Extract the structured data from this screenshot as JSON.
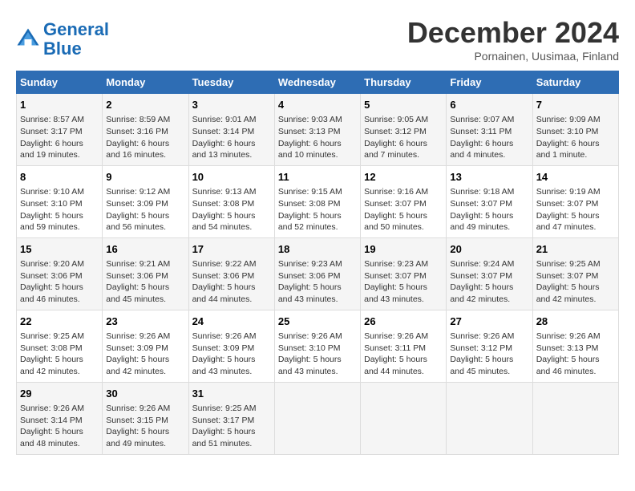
{
  "logo": {
    "line1": "General",
    "line2": "Blue"
  },
  "title": "December 2024",
  "subtitle": "Pornainen, Uusimaa, Finland",
  "days_of_week": [
    "Sunday",
    "Monday",
    "Tuesday",
    "Wednesday",
    "Thursday",
    "Friday",
    "Saturday"
  ],
  "weeks": [
    [
      {
        "day": 1,
        "sunrise": "Sunrise: 8:57 AM",
        "sunset": "Sunset: 3:17 PM",
        "daylight": "Daylight: 6 hours and 19 minutes."
      },
      {
        "day": 2,
        "sunrise": "Sunrise: 8:59 AM",
        "sunset": "Sunset: 3:16 PM",
        "daylight": "Daylight: 6 hours and 16 minutes."
      },
      {
        "day": 3,
        "sunrise": "Sunrise: 9:01 AM",
        "sunset": "Sunset: 3:14 PM",
        "daylight": "Daylight: 6 hours and 13 minutes."
      },
      {
        "day": 4,
        "sunrise": "Sunrise: 9:03 AM",
        "sunset": "Sunset: 3:13 PM",
        "daylight": "Daylight: 6 hours and 10 minutes."
      },
      {
        "day": 5,
        "sunrise": "Sunrise: 9:05 AM",
        "sunset": "Sunset: 3:12 PM",
        "daylight": "Daylight: 6 hours and 7 minutes."
      },
      {
        "day": 6,
        "sunrise": "Sunrise: 9:07 AM",
        "sunset": "Sunset: 3:11 PM",
        "daylight": "Daylight: 6 hours and 4 minutes."
      },
      {
        "day": 7,
        "sunrise": "Sunrise: 9:09 AM",
        "sunset": "Sunset: 3:10 PM",
        "daylight": "Daylight: 6 hours and 1 minute."
      }
    ],
    [
      {
        "day": 8,
        "sunrise": "Sunrise: 9:10 AM",
        "sunset": "Sunset: 3:10 PM",
        "daylight": "Daylight: 5 hours and 59 minutes."
      },
      {
        "day": 9,
        "sunrise": "Sunrise: 9:12 AM",
        "sunset": "Sunset: 3:09 PM",
        "daylight": "Daylight: 5 hours and 56 minutes."
      },
      {
        "day": 10,
        "sunrise": "Sunrise: 9:13 AM",
        "sunset": "Sunset: 3:08 PM",
        "daylight": "Daylight: 5 hours and 54 minutes."
      },
      {
        "day": 11,
        "sunrise": "Sunrise: 9:15 AM",
        "sunset": "Sunset: 3:08 PM",
        "daylight": "Daylight: 5 hours and 52 minutes."
      },
      {
        "day": 12,
        "sunrise": "Sunrise: 9:16 AM",
        "sunset": "Sunset: 3:07 PM",
        "daylight": "Daylight: 5 hours and 50 minutes."
      },
      {
        "day": 13,
        "sunrise": "Sunrise: 9:18 AM",
        "sunset": "Sunset: 3:07 PM",
        "daylight": "Daylight: 5 hours and 49 minutes."
      },
      {
        "day": 14,
        "sunrise": "Sunrise: 9:19 AM",
        "sunset": "Sunset: 3:07 PM",
        "daylight": "Daylight: 5 hours and 47 minutes."
      }
    ],
    [
      {
        "day": 15,
        "sunrise": "Sunrise: 9:20 AM",
        "sunset": "Sunset: 3:06 PM",
        "daylight": "Daylight: 5 hours and 46 minutes."
      },
      {
        "day": 16,
        "sunrise": "Sunrise: 9:21 AM",
        "sunset": "Sunset: 3:06 PM",
        "daylight": "Daylight: 5 hours and 45 minutes."
      },
      {
        "day": 17,
        "sunrise": "Sunrise: 9:22 AM",
        "sunset": "Sunset: 3:06 PM",
        "daylight": "Daylight: 5 hours and 44 minutes."
      },
      {
        "day": 18,
        "sunrise": "Sunrise: 9:23 AM",
        "sunset": "Sunset: 3:06 PM",
        "daylight": "Daylight: 5 hours and 43 minutes."
      },
      {
        "day": 19,
        "sunrise": "Sunrise: 9:23 AM",
        "sunset": "Sunset: 3:07 PM",
        "daylight": "Daylight: 5 hours and 43 minutes."
      },
      {
        "day": 20,
        "sunrise": "Sunrise: 9:24 AM",
        "sunset": "Sunset: 3:07 PM",
        "daylight": "Daylight: 5 hours and 42 minutes."
      },
      {
        "day": 21,
        "sunrise": "Sunrise: 9:25 AM",
        "sunset": "Sunset: 3:07 PM",
        "daylight": "Daylight: 5 hours and 42 minutes."
      }
    ],
    [
      {
        "day": 22,
        "sunrise": "Sunrise: 9:25 AM",
        "sunset": "Sunset: 3:08 PM",
        "daylight": "Daylight: 5 hours and 42 minutes."
      },
      {
        "day": 23,
        "sunrise": "Sunrise: 9:26 AM",
        "sunset": "Sunset: 3:09 PM",
        "daylight": "Daylight: 5 hours and 42 minutes."
      },
      {
        "day": 24,
        "sunrise": "Sunrise: 9:26 AM",
        "sunset": "Sunset: 3:09 PM",
        "daylight": "Daylight: 5 hours and 43 minutes."
      },
      {
        "day": 25,
        "sunrise": "Sunrise: 9:26 AM",
        "sunset": "Sunset: 3:10 PM",
        "daylight": "Daylight: 5 hours and 43 minutes."
      },
      {
        "day": 26,
        "sunrise": "Sunrise: 9:26 AM",
        "sunset": "Sunset: 3:11 PM",
        "daylight": "Daylight: 5 hours and 44 minutes."
      },
      {
        "day": 27,
        "sunrise": "Sunrise: 9:26 AM",
        "sunset": "Sunset: 3:12 PM",
        "daylight": "Daylight: 5 hours and 45 minutes."
      },
      {
        "day": 28,
        "sunrise": "Sunrise: 9:26 AM",
        "sunset": "Sunset: 3:13 PM",
        "daylight": "Daylight: 5 hours and 46 minutes."
      }
    ],
    [
      {
        "day": 29,
        "sunrise": "Sunrise: 9:26 AM",
        "sunset": "Sunset: 3:14 PM",
        "daylight": "Daylight: 5 hours and 48 minutes."
      },
      {
        "day": 30,
        "sunrise": "Sunrise: 9:26 AM",
        "sunset": "Sunset: 3:15 PM",
        "daylight": "Daylight: 5 hours and 49 minutes."
      },
      {
        "day": 31,
        "sunrise": "Sunrise: 9:25 AM",
        "sunset": "Sunset: 3:17 PM",
        "daylight": "Daylight: 5 hours and 51 minutes."
      },
      null,
      null,
      null,
      null
    ]
  ]
}
